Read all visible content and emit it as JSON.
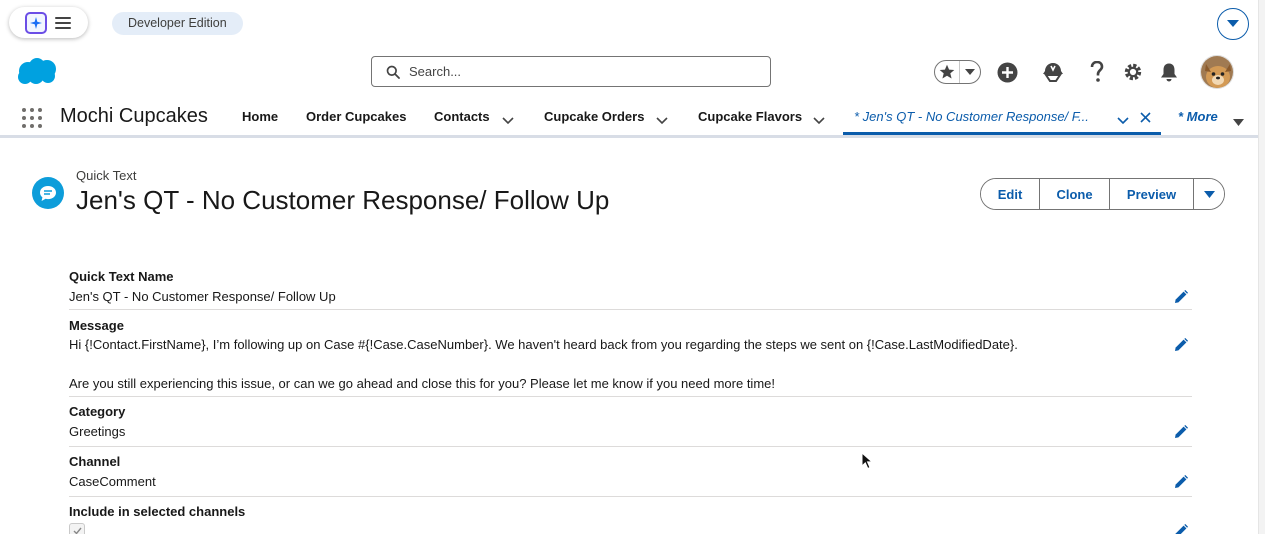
{
  "top_bar": {
    "edition_badge": "Developer Edition"
  },
  "header": {
    "search_placeholder": "Search..."
  },
  "nav": {
    "app_name": "Mochi Cupcakes",
    "items": [
      "Home",
      "Order Cupcakes",
      "Contacts",
      "Cupcake Orders",
      "Cupcake Flavors"
    ],
    "active_tab": "* Jen's QT - No Customer Response/ F...",
    "more_label": "* More"
  },
  "record": {
    "object_type": "Quick Text",
    "title": "Jen's QT - No Customer Response/ Follow Up",
    "actions": {
      "edit": "Edit",
      "clone": "Clone",
      "preview": "Preview"
    }
  },
  "fields": {
    "name_label": "Quick Text Name",
    "name_value": "Jen's QT - No Customer Response/ Follow Up",
    "message_label": "Message",
    "message_line1": "Hi {!Contact.FirstName}, I’m following up on Case #{!Case.CaseNumber}. We haven't heard back from you regarding the steps we sent on {!Case.LastModifiedDate}.",
    "message_line2": "Are you still experiencing this issue, or can we go ahead and close this for you? Please let me know if you need more time!",
    "category_label": "Category",
    "category_value": "Greetings",
    "channel_label": "Channel",
    "channel_value": "CaseComment",
    "include_label": "Include in selected channels",
    "include_checked": true
  },
  "colors": {
    "brand_blue": "#0b5cab",
    "salesforce_cloud": "#00a1e0",
    "quick_text_icon": "#0d9dda"
  }
}
